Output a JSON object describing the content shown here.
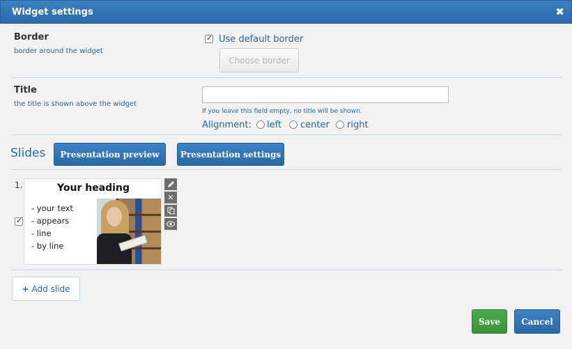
{
  "dialog": {
    "title": "Widget settings",
    "close_glyph": "✖"
  },
  "border": {
    "title": "Border",
    "subtitle": "border around the widget",
    "use_default_label": "Use default border",
    "use_default_checked": true,
    "choose_button": "Choose border"
  },
  "title_section": {
    "title": "Title",
    "subtitle": "the title is shown above the widget",
    "input_value": "",
    "hint": "If you leave this field empty, no title will be shown.",
    "alignment_label": "Alignment:",
    "options": [
      "left",
      "center",
      "right"
    ]
  },
  "slides": {
    "heading": "Slides",
    "preview_button": "Presentation preview",
    "settings_button": "Presentation settings",
    "items": [
      {
        "number": "1.",
        "checked": true,
        "heading": "Your heading",
        "lines": [
          "- your text",
          "- appears",
          "- line",
          "- by line"
        ]
      }
    ],
    "tools": [
      "pencil-icon",
      "close-icon",
      "copy-icon",
      "eye-icon"
    ],
    "add_button": "Add slide",
    "add_glyph": "+"
  },
  "footer": {
    "save": "Save",
    "cancel": "Cancel"
  },
  "colors": {
    "accent": "#2a6aa8",
    "save": "#3a923a",
    "background": "#f2f2f2"
  }
}
